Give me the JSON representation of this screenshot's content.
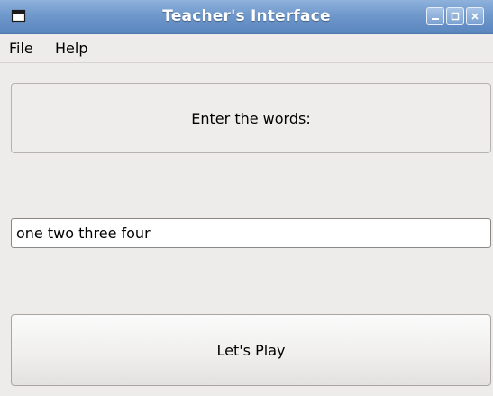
{
  "window": {
    "title": "Teacher's Interface",
    "controls": {
      "minimize_icon": "minimize-icon",
      "maximize_icon": "maximize-icon",
      "close_icon": "close-icon"
    }
  },
  "menubar": {
    "items": [
      {
        "label": "File"
      },
      {
        "label": "Help"
      }
    ]
  },
  "main": {
    "prompt_label": "Enter the words:",
    "words_input": {
      "value": "one two three four",
      "placeholder": ""
    },
    "play_button_label": "Let's Play"
  },
  "colors": {
    "titlebar": "#6f98cb",
    "window_bg": "#edeceb"
  }
}
